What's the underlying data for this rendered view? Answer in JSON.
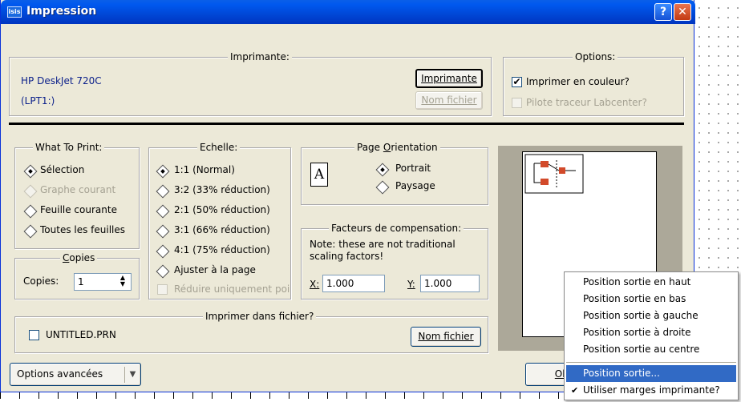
{
  "window": {
    "title": "Impression",
    "logo_text": "isis"
  },
  "printer": {
    "legend": "Imprimante:",
    "name": "HP DeskJet 720C",
    "port": "(LPT1:)",
    "printer_button": "Imprimante",
    "filename_button": "Nom fichier"
  },
  "options": {
    "legend": "Options:",
    "color_print": "Imprimer en couleur?",
    "plotter_driver": "Pilote traceur Labcenter?"
  },
  "what_to_print": {
    "legend": "What To Print:",
    "items": [
      "Sélection",
      "Graphe courant",
      "Feuille courante",
      "Toutes les feuilles"
    ],
    "selected": "Sélection"
  },
  "copies": {
    "legend": "Copies",
    "label": "Copies:",
    "value": "1"
  },
  "scale": {
    "legend": "Echelle:",
    "items": [
      "1:1 (Normal)",
      "3:2 (33% réduction)",
      "2:1 (50% réduction)",
      "3:1 (66% réduction)",
      "4:1 (75% réduction)",
      "Ajuster à la page"
    ],
    "selected": "1:1 (Normal)",
    "reduce_only": "Réduire uniquement poi"
  },
  "orientation": {
    "legend": "Page Orientation",
    "portrait": "Portrait",
    "landscape": "Paysage",
    "selected": "Portrait",
    "icon_letter": "A"
  },
  "compensation": {
    "legend": "Facteurs de compensation:",
    "note": "Note: these are not traditional scaling factors!",
    "x_label": "X:",
    "x_value": "1.000",
    "y_label": "Y:",
    "y_value": "1.000"
  },
  "print_to_file": {
    "legend": "Imprimer dans fichier?",
    "filename": "UNTITLED.PRN",
    "button": "Nom fichier"
  },
  "footer": {
    "advanced_options": "Options avancées",
    "ok_partial": "Ok"
  },
  "context_menu": {
    "items": [
      "Position sortie en haut",
      "Position sortie en bas",
      "Position sortie à gauche",
      "Position sortie à droite",
      "Position sortie au centre"
    ],
    "highlighted": "Position sortie...",
    "use_margins": "Utiliser marges imprimante?"
  },
  "colors": {
    "dialog_bg": "#ECE9D8",
    "title_blue": "#0058EE",
    "highlight": "#316AC5"
  }
}
